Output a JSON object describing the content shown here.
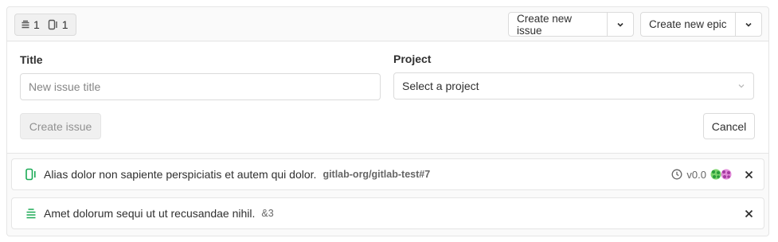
{
  "header": {
    "epic_count": "1",
    "issue_count": "1",
    "create_issue_label": "Create new issue",
    "create_epic_label": "Create new epic"
  },
  "form": {
    "title_label": "Title",
    "title_placeholder": "New issue title",
    "project_label": "Project",
    "project_placeholder": "Select a project",
    "submit_label": "Create issue",
    "cancel_label": "Cancel"
  },
  "items": [
    {
      "type": "issue",
      "title": "Alias dolor non sapiente perspiciatis et autem qui dolor.",
      "reference": "gitlab-org/gitlab-test#7",
      "milestone": "v0.0",
      "icon": "issue-open-icon"
    },
    {
      "type": "epic",
      "title": "Amet dolorum sequi ut ut recusandae nihil.",
      "reference": "&3",
      "icon": "epic-icon"
    }
  ],
  "colors": {
    "open_green": "#1aaa55",
    "border": "#e5e5e5"
  }
}
